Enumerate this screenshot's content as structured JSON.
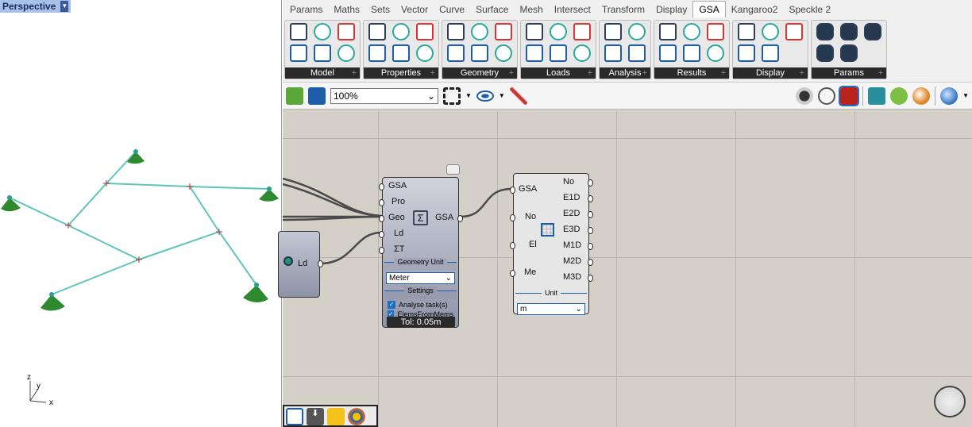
{
  "viewport": {
    "title": "Perspective",
    "axes": {
      "x": "x",
      "y": "y",
      "z": "z"
    }
  },
  "tabs": [
    "Params",
    "Maths",
    "Sets",
    "Vector",
    "Curve",
    "Surface",
    "Mesh",
    "Intersect",
    "Transform",
    "Display",
    "GSA",
    "Kangaroo2",
    "Speckle 2"
  ],
  "active_tab": "GSA",
  "ribbon_groups": [
    {
      "label": "Model",
      "icons": [
        "open-model-icon",
        "save-model-icon",
        "grid-model-icon",
        "section-icon",
        "list-add-icon",
        "list-refresh-icon"
      ]
    },
    {
      "label": "Properties",
      "icons": [
        "prop2d-icon",
        "prop3d-icon",
        "section-add-icon",
        "section-info-icon",
        "edit-prop-icon",
        "edit-prop2-icon"
      ]
    },
    {
      "label": "Geometry",
      "icons": [
        "node-support-icon",
        "node-edit-icon",
        "element1d-icon",
        "mesh2d-icon",
        "member-icon",
        "mesh-add-icon"
      ]
    },
    {
      "label": "Loads",
      "icons": [
        "beam-load-icon",
        "thermal-load-icon",
        "point-load-icon",
        "face-load-icon",
        "node-load-icon",
        "edit-load-icon"
      ]
    },
    {
      "label": "Analysis",
      "icons": [
        "sigma-icon",
        "sigma-c-info-icon",
        "sigma-a-icon",
        "sigma-c-icon"
      ]
    },
    {
      "label": "Results",
      "icons": [
        "results-select-icon",
        "results-pick-icon",
        "displacement-icon",
        "reaction-icon",
        "beam-force-icon",
        "diagram-icon"
      ]
    },
    {
      "label": "Display",
      "icons": [
        "annotate-icon",
        "mesh-add-icon",
        "layers-icon",
        "layers2-icon",
        "load-arrow-icon"
      ]
    },
    {
      "label": "Params",
      "icons": [
        "gsa-param-icon",
        "prop-param-icon",
        "section-param-icon",
        "node-param-icon",
        "mesh-param-icon"
      ]
    }
  ],
  "toolbar": {
    "zoom": "100%"
  },
  "components": {
    "analyse": {
      "inputs": [
        "GSA",
        "Pro",
        "Geo",
        "Ld",
        "ΣT"
      ],
      "output": "GSA",
      "unit_label": "Geometry Unit",
      "unit_value": "Meter",
      "settings_label": "Settings",
      "checkboxes": [
        {
          "label": "Analyse task(s)",
          "checked": true
        },
        {
          "label": "ElemsFromMems",
          "checked": true
        }
      ],
      "tolerance": "Tol: 0.05m"
    },
    "load": {
      "output": "Ld"
    },
    "edit_model": {
      "inputs": [
        "GSA",
        "No",
        "El",
        "Me"
      ],
      "outputs": [
        "No",
        "E1D",
        "E2D",
        "E3D",
        "M1D",
        "M2D",
        "M3D"
      ],
      "unit_label": "Unit",
      "unit_value": "m"
    }
  },
  "colors": {
    "accent": "#1e5ea8",
    "member": "#5fc4bb",
    "support": "#2f8a2f",
    "canvas": "#d4d0c8"
  }
}
